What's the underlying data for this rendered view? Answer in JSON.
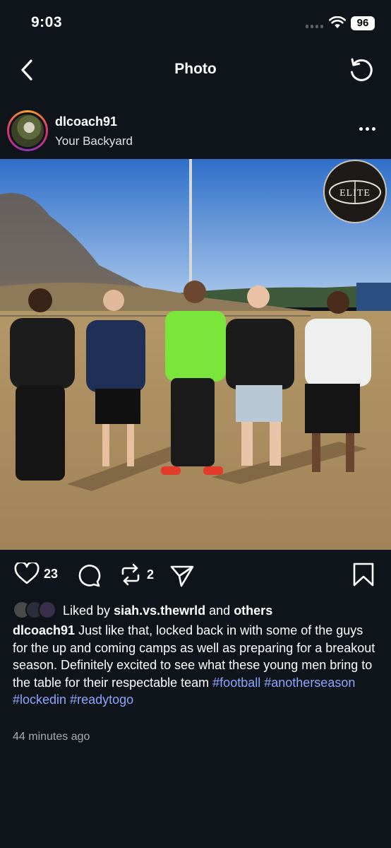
{
  "status_bar": {
    "time": "9:03",
    "battery": "96"
  },
  "nav": {
    "title": "Photo"
  },
  "post": {
    "username": "dlcoach91",
    "location": "Your Backyard",
    "badge_text": "ELITE"
  },
  "actions": {
    "likes_count": "23",
    "reposts_count": "2"
  },
  "liked_by": {
    "prefix": "Liked by",
    "user": "siah.vs.thewrld",
    "conjunction": "and",
    "others": "others"
  },
  "caption": {
    "user": "dlcoach91",
    "text": "Just like that, locked back in with some of the guys for the up and coming camps as well as preparing for a breakout season. Definitely excited to see what these young men bring to the table for their respectable team",
    "hashtags": [
      "#football",
      "#anotherseason",
      "#lockedin",
      "#readytogo"
    ]
  },
  "timestamp": "44 minutes ago",
  "colors": {
    "background": "#0f141a",
    "hashtag": "#8ba6ff",
    "secondary_text": "#a4abb3"
  }
}
